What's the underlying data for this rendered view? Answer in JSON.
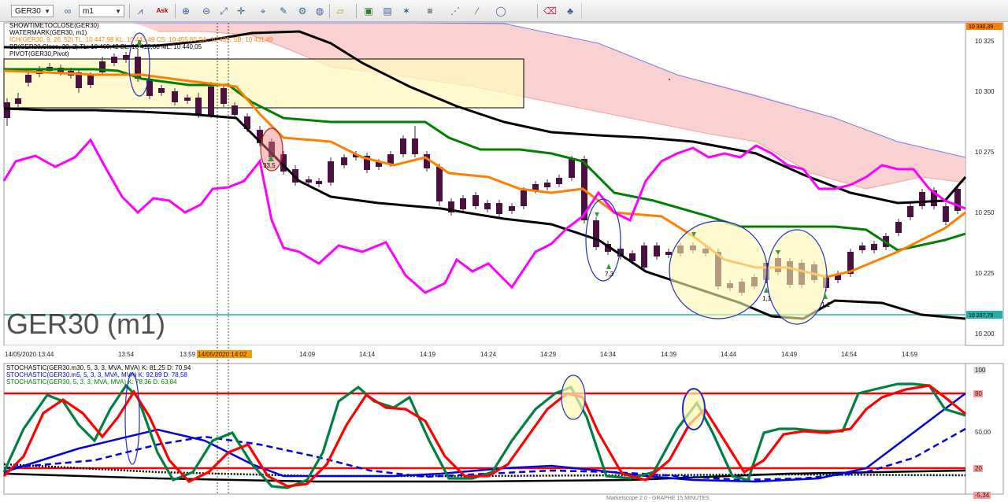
{
  "toolbar": {
    "symbol": "GER30",
    "timeframe": "m1",
    "ask_label": "Ask",
    "icons": [
      "chart-type-icon",
      "ask-icon",
      "zoom-in-icon",
      "zoom-out-icon",
      "zoom-fit-icon",
      "crosshair-icon",
      "cursor-icon",
      "text-icon",
      "hand-icon",
      "objects-icon",
      "globe-icon",
      "ruler-icon",
      "screenshot-icon",
      "template-icon",
      "magic-icon",
      "lines-icon",
      "fibonacci-icon",
      "pen-icon",
      "shapes-icon",
      "ellipse-icon",
      "eraser-icon",
      "signals-icon"
    ]
  },
  "price_pane": {
    "legend": [
      {
        "text": "SHOWTIMETOCLOSE(GER30)",
        "color": "#000000"
      },
      {
        "text": "WATERMARK(GER30, m1)",
        "color": "#000000"
      },
      {
        "text": "ICH(GER30, 9, 26, 52)  TL: 10 447,98  KL: 10 443,49  CS: 10 455,80  SA: 10 439,  SB: 10 431,49",
        "color": "#ff7f00",
        "color2": "#ff00ff"
      },
      {
        "text": "BB(GER30,Close, 20, 2)  TL: 10 469,42  BL: 10 410,68  ML: 10 440,05",
        "color": "#000000"
      },
      {
        "text": "PIVOT(GER30,Pivot)",
        "color": "#000000"
      }
    ],
    "watermark": "GER30 (m1)",
    "current_price_tag": "10 207,79",
    "top_price_tag": "10 330,39",
    "y_ticks": [
      "10 325",
      "10 300",
      "10 275",
      "10 250",
      "10 225",
      "10 200"
    ],
    "x_ticks": [
      "14/05/2020 13:44",
      "13:54",
      "13:59",
      "14/05/2020 14:02",
      "14:09",
      "14:14",
      "14:19",
      "14:24",
      "14:29",
      "14:34",
      "14:39",
      "14:44",
      "14:49",
      "14:54",
      "14:59"
    ],
    "annotations": [
      "33,5",
      "7,3",
      "1,1",
      "1,1"
    ],
    "colors": {
      "ich_cloud": "#f9c4c4",
      "kijun": "#ff7f00",
      "tenkan": "#008000",
      "chikou": "#ff00ff",
      "bb": "#000000",
      "bull": "#7b7bef",
      "bear": "#4a1040",
      "pivot_line": "#20b2aa"
    }
  },
  "stoch_pane": {
    "legend": [
      {
        "text": "STOCHASTIC(GER30.m30, 5, 3, 3, MVA, MVA)  K: 81,25  D: 70,94",
        "color": "#000000"
      },
      {
        "text": "STOCHASTIC(GER30.m5, 5, 3, 3, MVA, MVA)  K: 92,89  D: 78,58",
        "color": "#0000ff"
      },
      {
        "text": "STOCHASTIC(GER30, 5, 3, 3, MVA, MVA)  K: 78,36  D: 63,84",
        "color": "#008000"
      }
    ],
    "y_ticks": [
      "100",
      "80",
      "50,00",
      "20",
      "-5,34"
    ],
    "footer": "Marketscope 2.0 - GRAPHE 15 MINUTES"
  }
}
